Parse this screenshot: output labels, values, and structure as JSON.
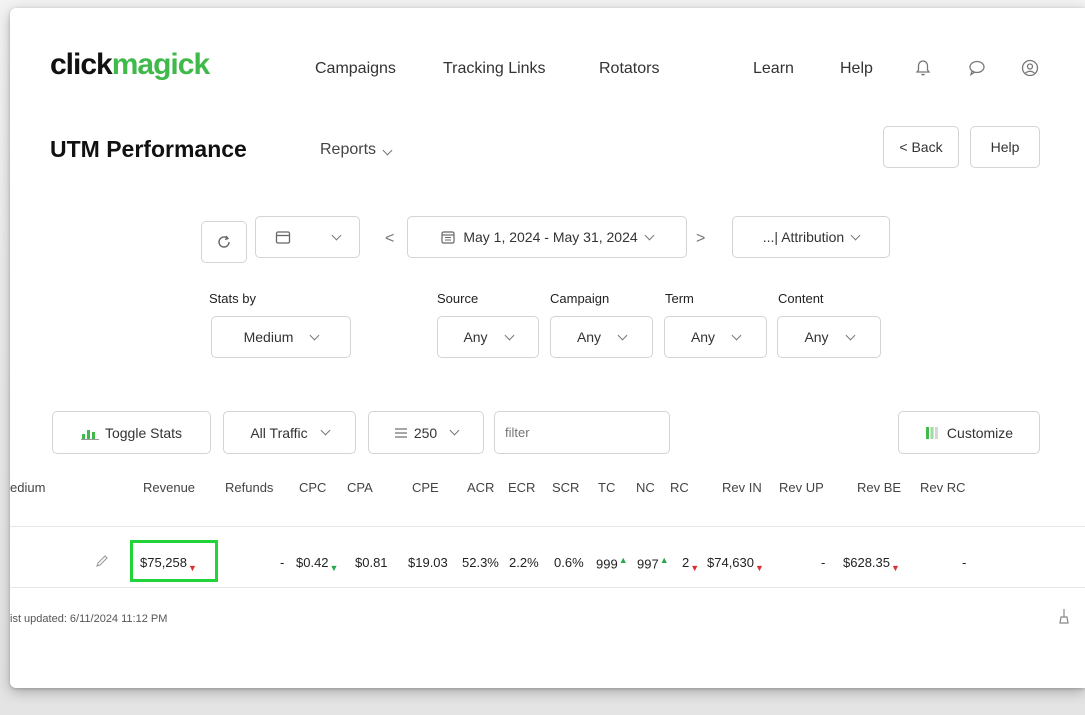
{
  "brand": {
    "part1": "click",
    "part2": "magick"
  },
  "nav": {
    "campaigns": "Campaigns",
    "tracking_links": "Tracking Links",
    "rotators": "Rotators",
    "learn": "Learn",
    "help": "Help"
  },
  "header": {
    "title": "UTM Performance",
    "reports": "Reports",
    "back": "< Back",
    "help": "Help"
  },
  "toolbar": {
    "date_range": "May 1, 2024 - May 31, 2024",
    "attribution": "...| Attribution"
  },
  "filters": {
    "stats_by_label": "Stats by",
    "stats_by_value": "Medium",
    "source_label": "Source",
    "source_value": "Any",
    "campaign_label": "Campaign",
    "campaign_value": "Any",
    "term_label": "Term",
    "term_value": "Any",
    "content_label": "Content",
    "content_value": "Any"
  },
  "controls": {
    "toggle_stats": "Toggle Stats",
    "traffic": "All Traffic",
    "per_page": "250",
    "filter_placeholder": "filter",
    "customize": "Customize"
  },
  "table": {
    "headers": [
      "edium",
      "Revenue",
      "Refunds",
      "CPC",
      "CPA",
      "CPE",
      "ACR",
      "ECR",
      "SCR",
      "TC",
      "NC",
      "RC",
      "Rev IN",
      "Rev UP",
      "Rev BE",
      "Rev RC"
    ],
    "row": {
      "revenue": "$75,258",
      "refunds": "-",
      "cpc": "$0.42",
      "cpa": "$0.81",
      "cpe": "$19.03",
      "acr": "52.3%",
      "ecr": "2.2%",
      "scr": "0.6%",
      "tc": "999",
      "nc": "997",
      "rc": "2",
      "rev_in": "$74,630",
      "rev_up": "-",
      "rev_be": "$628.35",
      "rev_rc": "-"
    }
  },
  "footer": {
    "last_updated": "ist updated: 6/11/2024 11:12 PM"
  },
  "colors": {
    "brand_green": "#3fb94a",
    "highlight_green": "#22d33a",
    "up": "#2aa84a",
    "down": "#d93030"
  }
}
